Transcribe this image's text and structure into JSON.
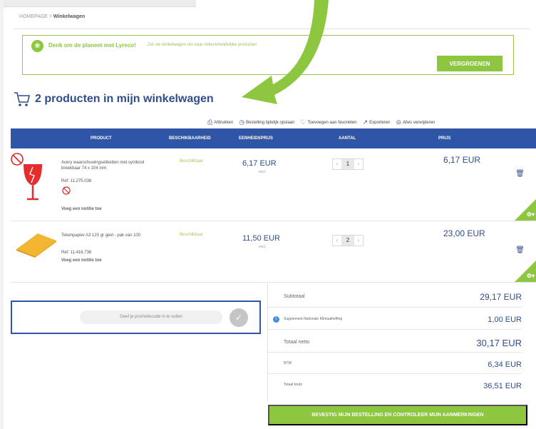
{
  "breadcrumb": {
    "home": "HOMEPAGE",
    "separator": " > ",
    "current": "Winkelwagen"
  },
  "promo_banner": {
    "title": "Denk om de planeet met Lyreco!",
    "subtitle": "Zet uw winkelwagen om naar milieuvriendelijke producten",
    "button": "VERGROENEN"
  },
  "cart": {
    "title": "2 producten in mijn winkelwagen"
  },
  "actions": [
    {
      "label": "Afdrukken",
      "icon": "printer-icon"
    },
    {
      "label": "Bestelling tijdelijk opslaan",
      "icon": "save-clock-icon"
    },
    {
      "label": "Toevoegen aan favorieten",
      "icon": "heart-icon"
    },
    {
      "label": "Exporteren",
      "icon": "export-icon"
    },
    {
      "label": "Alles verwijderen",
      "icon": "remove-all-icon"
    }
  ],
  "table_headers": [
    "PRODUCT",
    "BESCHIKBAARHEID",
    "EENHEIDSPRIJS",
    "AANTAL",
    "PRIJS"
  ],
  "items": [
    {
      "name": "Avery waarschuwingsetiketten met symbool breekbaar 74 x 104 mm",
      "ref": "Ref: 11.275.038",
      "note": "Voeg een notitie toe",
      "availability": "Beschikbaar",
      "unit_price": "6,17 EUR",
      "unit_sub": "excl.",
      "quantity": "1",
      "total": "6,17 EUR"
    },
    {
      "name": "Tekenpapier A3 120 gr geel - pak van 100",
      "ref": "Ref: 11.416.736",
      "note": "Voeg een notitie toe",
      "availability": "Beschikbaar",
      "unit_price": "11,50 EUR",
      "unit_sub": "excl.",
      "quantity": "2",
      "total": "23,00 EUR"
    }
  ],
  "promo_code": {
    "placeholder": "Geef je promotiecode in te vullen"
  },
  "summary": {
    "subtotal_label": "Subtotaal",
    "subtotal": "29,17 EUR",
    "supplement_label": "Supplement Nationale Klimaatheffing",
    "supplement": "1,00 EUR",
    "net_label": "Totaal netto",
    "net": "30,17 EUR",
    "vat_label": "BTW",
    "vat": "6,34 EUR",
    "gross_label": "Totaal bruto",
    "gross": "36,51 EUR"
  },
  "confirm_button": "BEVESTIG MIJN BESTELLING EN CONTROLEER MIJN AANMERKINGEN",
  "colors": {
    "accent_green": "#8dc63f",
    "header_blue": "#2e55a6",
    "text_blue": "#2f4e8a"
  }
}
